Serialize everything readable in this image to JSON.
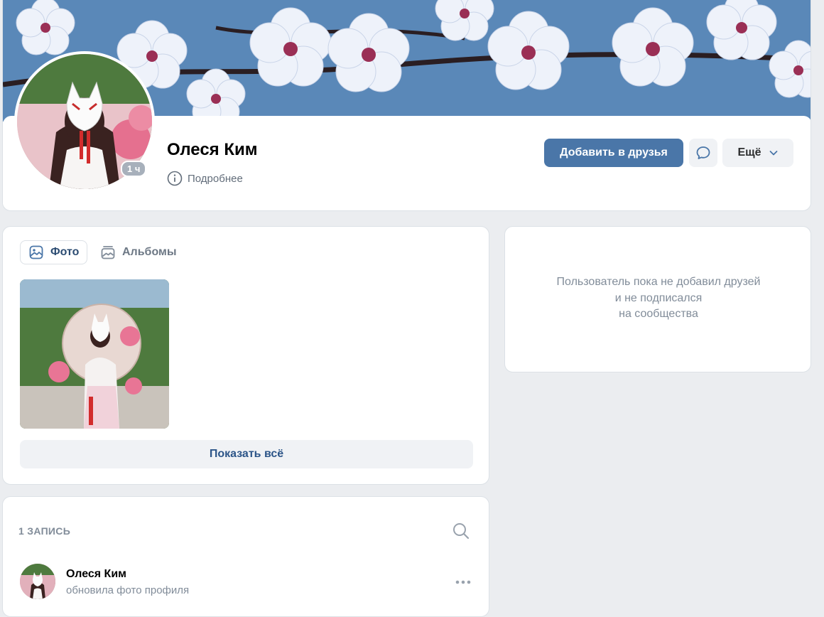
{
  "profile": {
    "name": "Олеся Ким",
    "online_badge": "1 ч",
    "details_label": "Подробнее",
    "add_friend_label": "Добавить в друзья",
    "more_label": "Ещё"
  },
  "photos": {
    "tabs": [
      {
        "label": "Фото",
        "active": true
      },
      {
        "label": "Альбомы",
        "active": false
      }
    ],
    "show_all_label": "Показать всё"
  },
  "friends": {
    "empty_lines": [
      "Пользователь пока не добавил друзей",
      "и не подписался",
      "на сообщества"
    ]
  },
  "wall": {
    "count_label": "1 ЗАПИСЬ",
    "post": {
      "author": "Олеся Ким",
      "action": "обновила фото профиля"
    }
  },
  "colors": {
    "accent": "#4a76a8",
    "page_bg": "#ebedf0",
    "muted_text": "#818c99"
  },
  "icons": {
    "details": "info-icon",
    "message": "chat-bubble-icon",
    "more": "chevron-down-icon",
    "photo_tab": "image-icon",
    "albums_tab": "albums-icon",
    "search": "search-icon",
    "post_menu": "more-horizontal-icon"
  }
}
